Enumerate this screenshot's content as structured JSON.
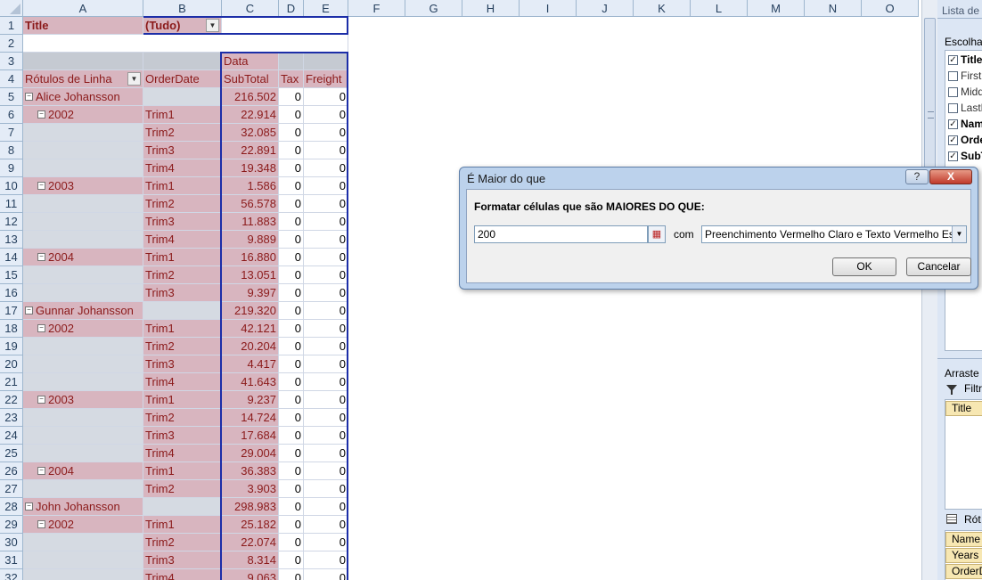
{
  "columns": [
    "A",
    "B",
    "C",
    "D",
    "E",
    "F",
    "G",
    "H",
    "I",
    "J",
    "K",
    "L",
    "M",
    "N",
    "O"
  ],
  "rows": [
    "1",
    "2",
    "3",
    "4",
    "5",
    "6",
    "7",
    "8",
    "9",
    "10",
    "11",
    "12",
    "13",
    "14",
    "15",
    "16",
    "17",
    "18",
    "19",
    "20",
    "21",
    "22",
    "23",
    "24",
    "25",
    "26",
    "27",
    "28",
    "29",
    "30",
    "31",
    "32"
  ],
  "pivot": {
    "filter_label": "Title",
    "filter_value": "(Tudo)",
    "data_label": "Data",
    "row_labels_header": "Rótulos de Linha",
    "order_date_header": "OrderDate",
    "subtotal_header": "SubTotal",
    "tax_header": "Tax",
    "freight_header": "Freight",
    "lines": [
      {
        "kind": "person",
        "a": "Alice Johansson",
        "b": "",
        "sub": "216.502",
        "tax": "0",
        "fr": "0"
      },
      {
        "kind": "year",
        "a": "2002",
        "b": "Trim1",
        "sub": "22.914",
        "tax": "0",
        "fr": "0"
      },
      {
        "kind": "q",
        "a": "",
        "b": "Trim2",
        "sub": "32.085",
        "tax": "0",
        "fr": "0"
      },
      {
        "kind": "q",
        "a": "",
        "b": "Trim3",
        "sub": "22.891",
        "tax": "0",
        "fr": "0"
      },
      {
        "kind": "q",
        "a": "",
        "b": "Trim4",
        "sub": "19.348",
        "tax": "0",
        "fr": "0"
      },
      {
        "kind": "year",
        "a": "2003",
        "b": "Trim1",
        "sub": "1.586",
        "tax": "0",
        "fr": "0"
      },
      {
        "kind": "q",
        "a": "",
        "b": "Trim2",
        "sub": "56.578",
        "tax": "0",
        "fr": "0"
      },
      {
        "kind": "q",
        "a": "",
        "b": "Trim3",
        "sub": "11.883",
        "tax": "0",
        "fr": "0"
      },
      {
        "kind": "q",
        "a": "",
        "b": "Trim4",
        "sub": "9.889",
        "tax": "0",
        "fr": "0"
      },
      {
        "kind": "year",
        "a": "2004",
        "b": "Trim1",
        "sub": "16.880",
        "tax": "0",
        "fr": "0"
      },
      {
        "kind": "q",
        "a": "",
        "b": "Trim2",
        "sub": "13.051",
        "tax": "0",
        "fr": "0"
      },
      {
        "kind": "q",
        "a": "",
        "b": "Trim3",
        "sub": "9.397",
        "tax": "0",
        "fr": "0"
      },
      {
        "kind": "person",
        "a": "Gunnar Johansson",
        "b": "",
        "sub": "219.320",
        "tax": "0",
        "fr": "0"
      },
      {
        "kind": "year",
        "a": "2002",
        "b": "Trim1",
        "sub": "42.121",
        "tax": "0",
        "fr": "0"
      },
      {
        "kind": "q",
        "a": "",
        "b": "Trim2",
        "sub": "20.204",
        "tax": "0",
        "fr": "0"
      },
      {
        "kind": "q",
        "a": "",
        "b": "Trim3",
        "sub": "4.417",
        "tax": "0",
        "fr": "0"
      },
      {
        "kind": "q",
        "a": "",
        "b": "Trim4",
        "sub": "41.643",
        "tax": "0",
        "fr": "0"
      },
      {
        "kind": "year",
        "a": "2003",
        "b": "Trim1",
        "sub": "9.237",
        "tax": "0",
        "fr": "0"
      },
      {
        "kind": "q",
        "a": "",
        "b": "Trim2",
        "sub": "14.724",
        "tax": "0",
        "fr": "0"
      },
      {
        "kind": "q",
        "a": "",
        "b": "Trim3",
        "sub": "17.684",
        "tax": "0",
        "fr": "0"
      },
      {
        "kind": "q",
        "a": "",
        "b": "Trim4",
        "sub": "29.004",
        "tax": "0",
        "fr": "0"
      },
      {
        "kind": "year",
        "a": "2004",
        "b": "Trim1",
        "sub": "36.383",
        "tax": "0",
        "fr": "0"
      },
      {
        "kind": "q",
        "a": "",
        "b": "Trim2",
        "sub": "3.903",
        "tax": "0",
        "fr": "0"
      },
      {
        "kind": "person",
        "a": "John Johansson",
        "b": "",
        "sub": "298.983",
        "tax": "0",
        "fr": "0"
      },
      {
        "kind": "year",
        "a": "2002",
        "b": "Trim1",
        "sub": "25.182",
        "tax": "0",
        "fr": "0"
      },
      {
        "kind": "q",
        "a": "",
        "b": "Trim2",
        "sub": "22.074",
        "tax": "0",
        "fr": "0"
      },
      {
        "kind": "q",
        "a": "",
        "b": "Trim3",
        "sub": "8.314",
        "tax": "0",
        "fr": "0"
      },
      {
        "kind": "q",
        "a": "",
        "b": "Trim4",
        "sub": "9.063",
        "tax": "0",
        "fr": "0"
      }
    ]
  },
  "pane": {
    "title": "Lista de c",
    "choose_label": "Escolha c",
    "fields": [
      {
        "label": "Title",
        "checked": true,
        "bold": true
      },
      {
        "label": "FirstN",
        "checked": false,
        "bold": false
      },
      {
        "label": "Middl",
        "checked": false,
        "bold": false
      },
      {
        "label": "LastN",
        "checked": false,
        "bold": false
      },
      {
        "label": "Nam",
        "checked": true,
        "bold": true
      },
      {
        "label": "Orde",
        "checked": true,
        "bold": true
      },
      {
        "label": "SubT",
        "checked": true,
        "bold": true
      }
    ],
    "drag_label": "Arraste c",
    "filter_label": "Filtr",
    "filter_chip": "Title",
    "rows_label": "Rót",
    "row_chips": [
      "Name",
      "Years",
      "OrderD"
    ]
  },
  "dialog": {
    "title": "É Maior do que",
    "help": "?",
    "close": "X",
    "label": "Formatar células que são MAIORES DO QUE:",
    "value": "200",
    "com": "com",
    "format": "Preenchimento Vermelho Claro e Texto Vermelho Escuro",
    "ok": "OK",
    "cancel": "Cancelar"
  }
}
